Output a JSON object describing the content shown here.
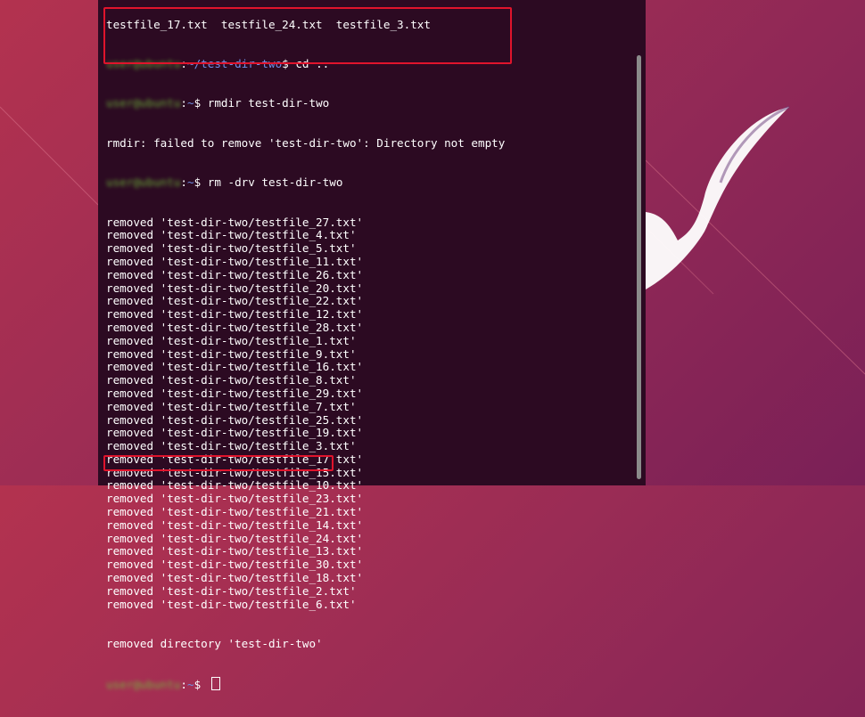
{
  "terminal": {
    "top_partial": "testfile_17.txt  testfile_24.txt  testfile_3.txt",
    "user_host_blurred": "user@ubuntu",
    "cmd1_path": "~/test-dir-two",
    "cmd1_suffix": "$ cd ..",
    "cmd2_path": "~",
    "cmd2_suffix": "$ rmdir test-dir-two",
    "error_line": "rmdir: failed to remove 'test-dir-two': Directory not empty",
    "cmd3_path": "~",
    "cmd3_suffix": "$ rm -drv test-dir-two",
    "removed_lines": [
      "removed 'test-dir-two/testfile_27.txt'",
      "removed 'test-dir-two/testfile_4.txt'",
      "removed 'test-dir-two/testfile_5.txt'",
      "removed 'test-dir-two/testfile_11.txt'",
      "removed 'test-dir-two/testfile_26.txt'",
      "removed 'test-dir-two/testfile_20.txt'",
      "removed 'test-dir-two/testfile_22.txt'",
      "removed 'test-dir-two/testfile_12.txt'",
      "removed 'test-dir-two/testfile_28.txt'",
      "removed 'test-dir-two/testfile_1.txt'",
      "removed 'test-dir-two/testfile_9.txt'",
      "removed 'test-dir-two/testfile_16.txt'",
      "removed 'test-dir-two/testfile_8.txt'",
      "removed 'test-dir-two/testfile_29.txt'",
      "removed 'test-dir-two/testfile_7.txt'",
      "removed 'test-dir-two/testfile_25.txt'",
      "removed 'test-dir-two/testfile_19.txt'",
      "removed 'test-dir-two/testfile_3.txt'",
      "removed 'test-dir-two/testfile_17.txt'",
      "removed 'test-dir-two/testfile_15.txt'",
      "removed 'test-dir-two/testfile_10.txt'",
      "removed 'test-dir-two/testfile_23.txt'",
      "removed 'test-dir-two/testfile_21.txt'",
      "removed 'test-dir-two/testfile_14.txt'",
      "removed 'test-dir-two/testfile_24.txt'",
      "removed 'test-dir-two/testfile_13.txt'",
      "removed 'test-dir-two/testfile_30.txt'",
      "removed 'test-dir-two/testfile_18.txt'",
      "removed 'test-dir-two/testfile_2.txt'",
      "removed 'test-dir-two/testfile_6.txt'"
    ],
    "removed_dir_line": "removed directory 'test-dir-two'",
    "final_path": "~",
    "final_suffix": "$ "
  },
  "colors": {
    "terminal_bg": "#2c0a22",
    "highlight_box": "#e0142c",
    "prompt_user": "#6fbf3a",
    "prompt_path": "#6f8fe6"
  }
}
